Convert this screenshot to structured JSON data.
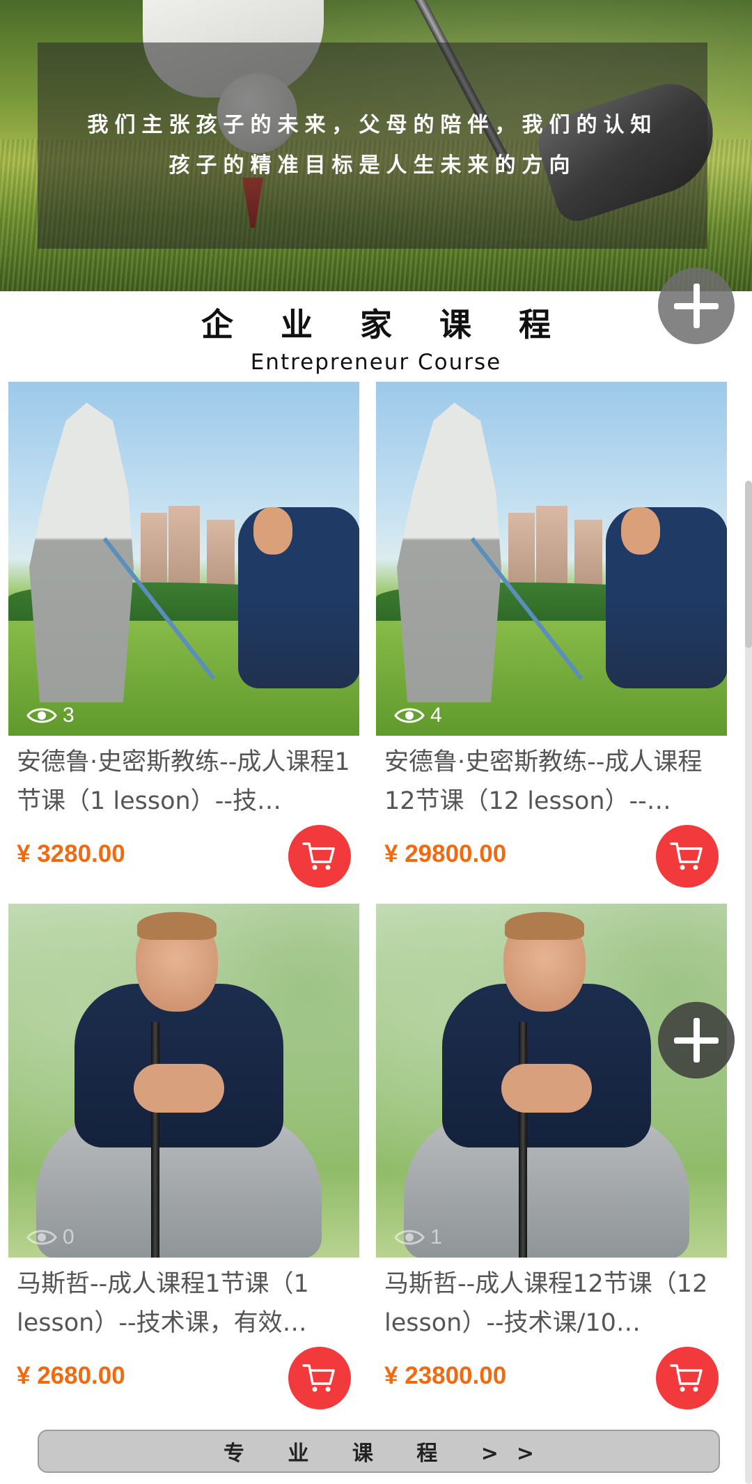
{
  "hero": {
    "line1": "我们主张孩子的未来，父母的陪伴，我们的认知",
    "line2": "孩子的精准目标是人生未来的方向"
  },
  "section": {
    "title_cn": "企 业 家 课 程",
    "title_en": "Entrepreneur Course"
  },
  "products": [
    {
      "title": "安德鲁·史密斯教练--成人课程1节课（1 lesson）--技…",
      "views": "3",
      "price": "¥ 3280.00",
      "cart_icon": "cart-icon"
    },
    {
      "title": "安德鲁·史密斯教练--成人课程12节课（12 lesson）--…",
      "views": "4",
      "price": "¥ 29800.00",
      "cart_icon": "cart-icon"
    },
    {
      "title": "马斯哲--成人课程1节课（1 lesson）--技术课，有效…",
      "views": "0",
      "price": "¥ 2680.00",
      "cart_icon": "cart-icon"
    },
    {
      "title": "马斯哲--成人课程12节课（12 lesson）--技术课/10…",
      "views": "1",
      "price": "¥ 23800.00",
      "cart_icon": "cart-icon"
    }
  ],
  "more_button": {
    "label": "专 业 课 程 >>"
  },
  "icons": {
    "fab": "plus-icon",
    "views": "eye-icon"
  },
  "colors": {
    "price": "#f26a10",
    "cart_button": "#f23a3c",
    "title_text": "#555555"
  }
}
